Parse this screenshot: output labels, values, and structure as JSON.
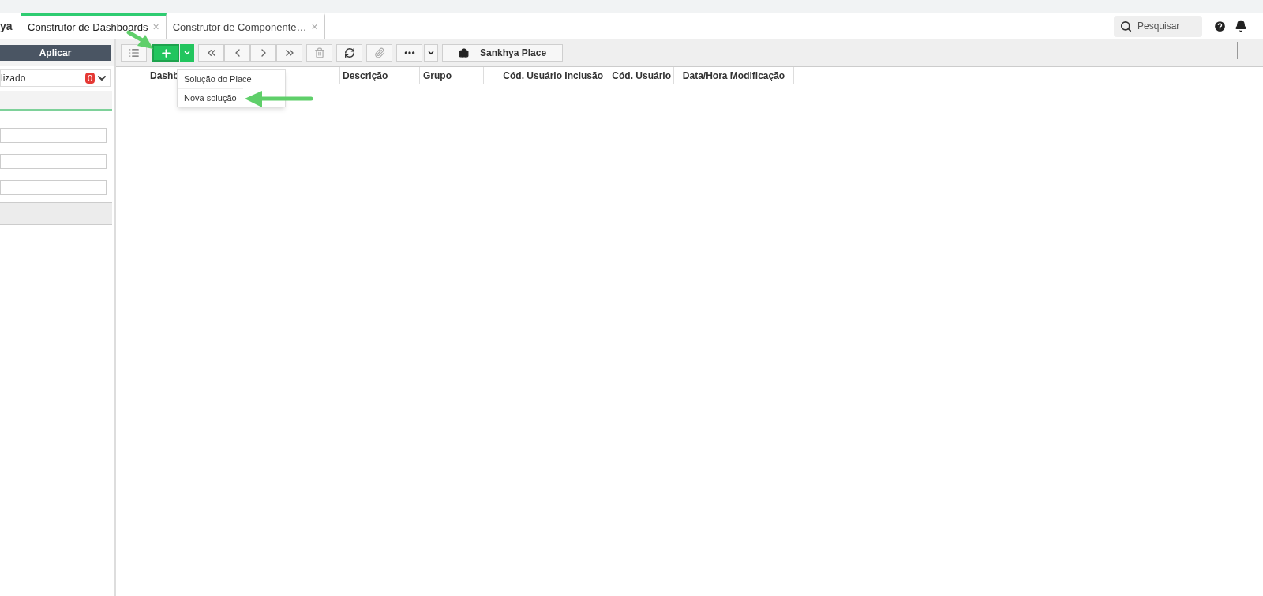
{
  "header": {
    "logo_text": "ya",
    "tabs": [
      {
        "label": "Construtor de Dashboards",
        "close": "×",
        "selected": true
      },
      {
        "label": "Construtor de Componente…",
        "close": "×",
        "selected": false
      }
    ],
    "search": {
      "placeholder": "Pesquisar"
    }
  },
  "left_panel": {
    "apply_button": "Aplicar",
    "filter": {
      "label": "lizado",
      "count": "0"
    },
    "fields": [
      {
        "kind": "text"
      },
      {
        "kind": "text"
      },
      {
        "kind": "text"
      }
    ]
  },
  "toolbar": {
    "place_button": "Sankhya Place"
  },
  "table": {
    "columns": [
      "Dashb",
      "Descrição",
      "Grupo",
      "Cód. Usuário Inclusão",
      "Cód. Usuário",
      "Data/Hora Modificação"
    ]
  },
  "add_menu": {
    "items": [
      "Solução do Place",
      "Nova solução"
    ]
  }
}
